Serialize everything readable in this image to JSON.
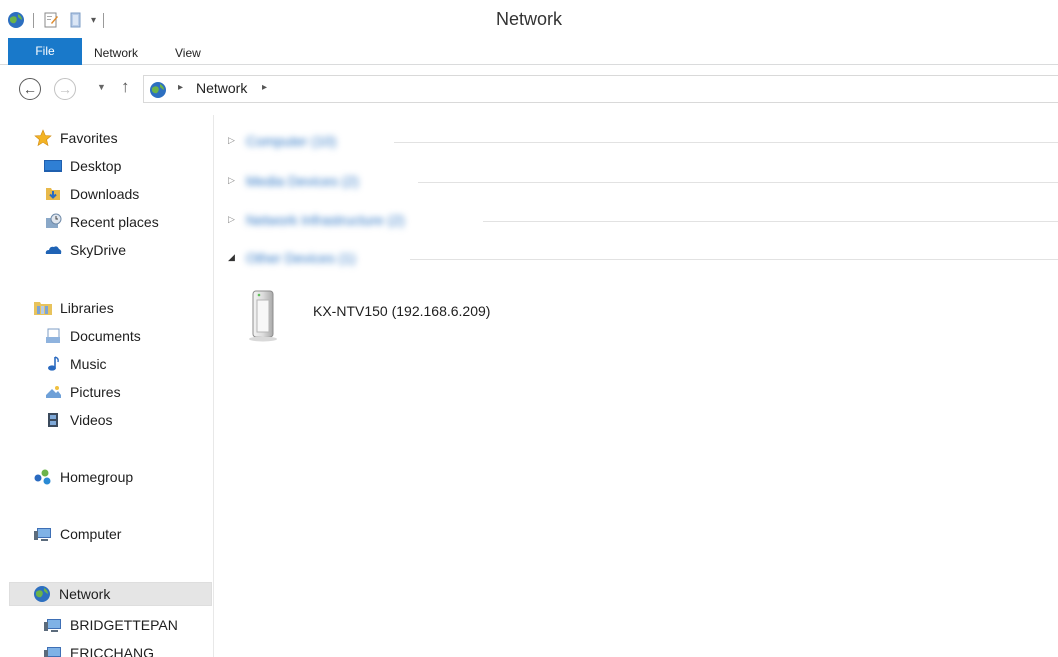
{
  "window": {
    "title": "Network"
  },
  "qat": {
    "icons": [
      "network-globe-icon",
      "properties-icon",
      "new-folder-icon",
      "customize-dropdown-icon"
    ]
  },
  "ribbon": {
    "tabs": [
      "File",
      "Network",
      "View"
    ],
    "active": "File"
  },
  "address": {
    "path": [
      "Network"
    ],
    "separator": "▸"
  },
  "nav": {
    "favorites": {
      "label": "Favorites",
      "items": [
        {
          "label": "Desktop",
          "icon": "desktop-icon"
        },
        {
          "label": "Downloads",
          "icon": "downloads-icon"
        },
        {
          "label": "Recent places",
          "icon": "recent-places-icon"
        },
        {
          "label": "SkyDrive",
          "icon": "skydrive-icon"
        }
      ]
    },
    "libraries": {
      "label": "Libraries",
      "items": [
        {
          "label": "Documents",
          "icon": "documents-icon"
        },
        {
          "label": "Music",
          "icon": "music-icon"
        },
        {
          "label": "Pictures",
          "icon": "pictures-icon"
        },
        {
          "label": "Videos",
          "icon": "videos-icon"
        }
      ]
    },
    "homegroup": {
      "label": "Homegroup"
    },
    "computer": {
      "label": "Computer"
    },
    "network": {
      "label": "Network",
      "selected": true,
      "items": [
        {
          "label": "BRIDGETTEPAN",
          "icon": "computer-icon"
        },
        {
          "label": "ERICCHANG",
          "icon": "computer-icon"
        }
      ]
    }
  },
  "content": {
    "groups": [
      {
        "title": "Computer (10)",
        "expanded": false
      },
      {
        "title": "Media Devices (2)",
        "expanded": false
      },
      {
        "title": "Network Infrastructure (2)",
        "expanded": false
      },
      {
        "title": "Other Devices (1)",
        "expanded": true
      }
    ],
    "device": {
      "name": "KX-NTV150 (192.168.6.209)",
      "icon": "network-device-icon"
    }
  },
  "colors": {
    "accent": "#1979ca",
    "group_title": "#2a74c4",
    "selection": "#e5e5e5"
  }
}
